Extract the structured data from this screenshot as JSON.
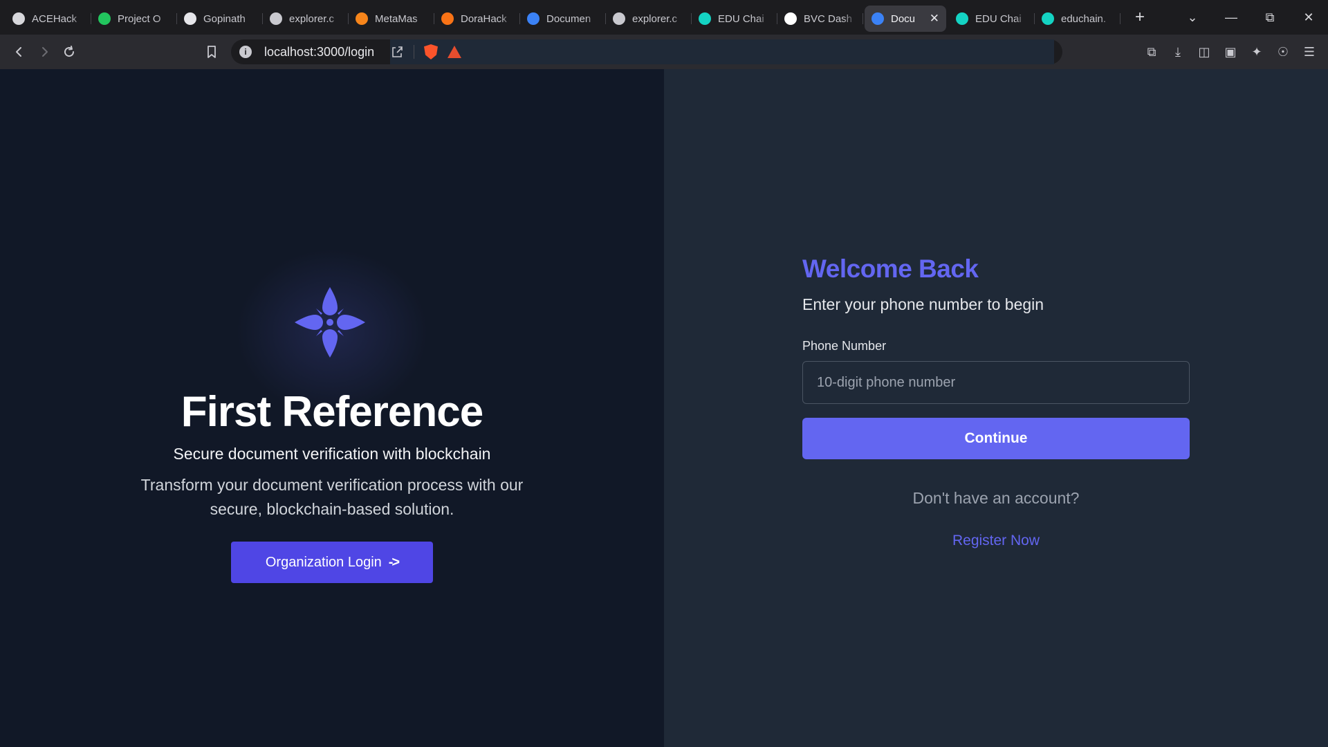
{
  "browser": {
    "tabs": [
      {
        "title": "ACEHack",
        "favicon": "openai-icon",
        "color": "#d7d7db"
      },
      {
        "title": "Project O",
        "favicon": "leaf-icon",
        "color": "#22c55e"
      },
      {
        "title": "Gopinath",
        "favicon": "github-icon",
        "color": "#e6e6ea"
      },
      {
        "title": "explorer.c",
        "favicon": "globe-icon",
        "color": "#c9c9cf"
      },
      {
        "title": "MetaMas",
        "favicon": "metamask-icon",
        "color": "#f6851b"
      },
      {
        "title": "DoraHack",
        "favicon": "dorahacks-icon",
        "color": "#f97316"
      },
      {
        "title": "Documen",
        "favicon": "shield-logo-icon",
        "color": "#3b82f6"
      },
      {
        "title": "explorer.c",
        "favicon": "globe-icon",
        "color": "#c9c9cf"
      },
      {
        "title": "EDU Chai",
        "favicon": "edu-chain-icon",
        "color": "#14d3c3"
      },
      {
        "title": "BVC Dash",
        "favicon": "triangle-icon",
        "color": "#ffffff"
      },
      {
        "title": "Docu",
        "favicon": "shield-logo-icon",
        "color": "#3b82f6",
        "active": true
      },
      {
        "title": "EDU Chai",
        "favicon": "edu-chain-icon",
        "color": "#14d3c3"
      },
      {
        "title": "educhain.",
        "favicon": "edu-chain-icon",
        "color": "#14d3c3"
      }
    ],
    "url": "localhost:3000/login"
  },
  "left": {
    "brand": "First Reference",
    "tagline": "Secure document verification with blockchain",
    "description": "Transform your document verification process with our secure, blockchain-based solution.",
    "org_login": "Organization Login",
    "org_login_arrow": "->",
    "accent": "#4f46e5"
  },
  "form": {
    "title": "Welcome Back",
    "subtitle": "Enter your phone number to begin",
    "phone_label": "Phone Number",
    "phone_placeholder": "10-digit phone number",
    "phone_value": "",
    "continue": "Continue",
    "no_account": "Don't have an account?",
    "register": "Register Now",
    "accent": "#6366f1"
  }
}
